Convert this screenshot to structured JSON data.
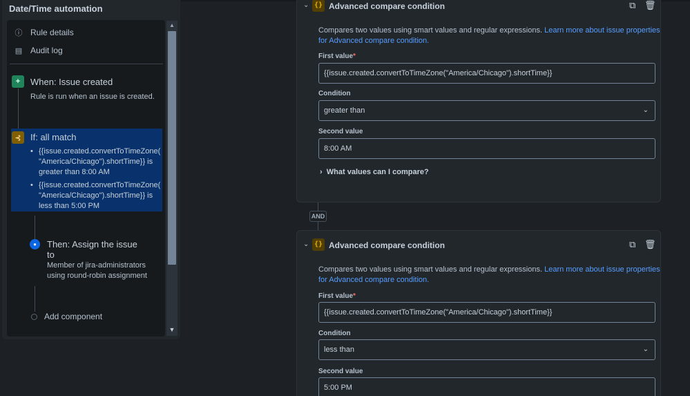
{
  "panel": {
    "title": "Date/Time automation",
    "nav": [
      {
        "label": "Rule details",
        "icon": "info-icon"
      },
      {
        "label": "Audit log",
        "icon": "clipboard-icon"
      }
    ]
  },
  "flow": {
    "trigger": {
      "title": "When: Issue created",
      "desc": "Rule is run when an issue is created."
    },
    "condition": {
      "title": "If: all match",
      "items": [
        "{{issue.created.convertToTimeZone( \"America/Chicago\").shortTime}} is greater than 8:00 AM",
        "{{issue.created.convertToTimeZone( \"America/Chicago\").shortTime}} is less than 5:00 PM"
      ]
    },
    "action": {
      "title": "Then: Assign the issue to",
      "desc": "Member of jira-administrators using round-robin assignment"
    },
    "add_component": "Add component"
  },
  "cards": [
    {
      "title": "Advanced compare condition",
      "desc": "Compares two values using smart values and regular expressions.",
      "link": "Learn more about issue properties for Advanced compare condition.",
      "first_label": "First value",
      "first_value": "{{issue.created.convertToTimeZone(\"America/Chicago\").shortTime}}",
      "condition_label": "Condition",
      "condition_value": "greater than",
      "second_label": "Second value",
      "second_value": "8:00 AM",
      "expand": "What values can I compare?"
    },
    {
      "title": "Advanced compare condition",
      "desc": "Compares two values using smart values and regular expressions.",
      "link": "Learn more about issue properties for Advanced compare condition.",
      "first_label": "First value",
      "first_value": "{{issue.created.convertToTimeZone(\"America/Chicago\").shortTime}}",
      "condition_label": "Condition",
      "condition_value": "less than",
      "second_label": "Second value",
      "second_value": "5:00 PM"
    }
  ],
  "and_label": "AND",
  "required_mark": "*",
  "colors": {
    "accent_link": "#579dff",
    "selected_bg": "#09326c",
    "trigger_green": "#1f845a",
    "condition_amber": "#e2b203"
  }
}
